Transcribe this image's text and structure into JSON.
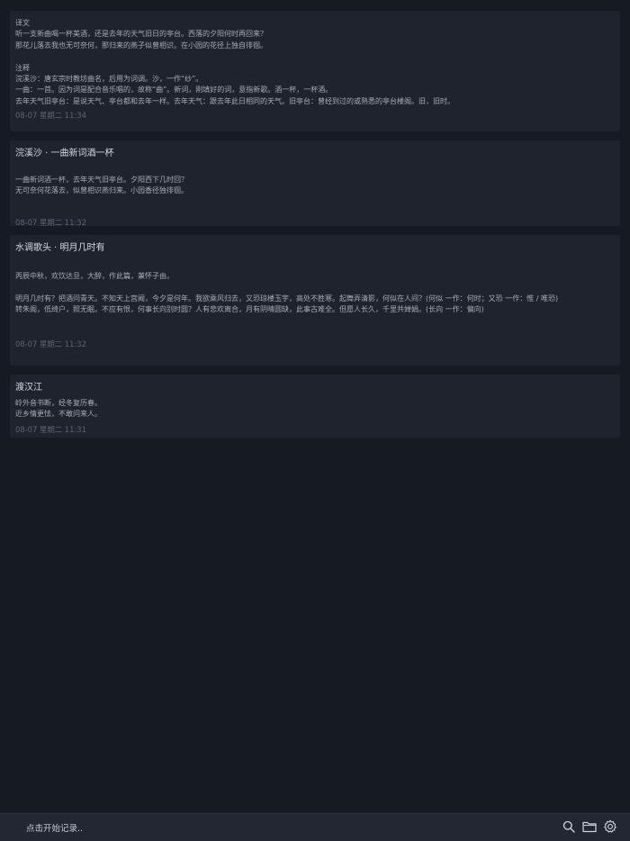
{
  "entries": [
    {
      "title": "",
      "body": "译文\n听一支新曲喝一杯美酒，还是去年的天气旧日的亭台。西落的夕阳何时再回来？\n那花儿落去我也无可奈何，那归来的燕子似曾相识。在小园的花径上独自徘徊。\n\n注释\n浣溪沙：唐玄宗时教坊曲名，后用为词调。沙，一作“纱”。\n一曲：一首。因为词是配合音乐唱的，故称“曲”。新词，刚填好的词，意指新歌。酒一杯，一杯酒。\n去年天气旧亭台：是说天气、亭台都和去年一样。去年天气：跟去年此日相同的天气。旧亭台：曾经到过的或熟悉的亭台楼阁。旧，旧时。",
      "time": "08-07 星期二 11:34"
    },
    {
      "title": "浣溪沙 · 一曲新词酒一杯",
      "body": "一曲新词酒一杯，去年天气旧亭台。夕阳西下几时回？\n无可奈何花落去，似曾相识燕归来。小园香径独徘徊。",
      "time": "08-07 星期二 11:32"
    },
    {
      "title": "水调歌头 · 明月几时有",
      "body": "丙辰中秋，欢饮达旦，大醉，作此篇，兼怀子由。\n\n明月几时有？把酒问青天。不知天上宫阙，今夕是何年。我欲乘风归去，又恐琼楼玉宇，高处不胜寒。起舞弄清影，何似在人间？(何似 一作：何时；又恐 一作：惟 / 唯恐)\n转朱阁，低绮户，照无眠。不应有恨，何事长向别时圆？人有悲欢离合，月有阴晴圆缺，此事古难全。但愿人长久，千里共婵娟。(长向 一作：偏向)",
      "time": "08-07 星期二 11:32"
    },
    {
      "title": "渡汉江",
      "body": "岭外音书断，经冬复历春。\n近乡情更怯，不敢问来人。",
      "time": "08-07 星期二 11:31"
    }
  ],
  "bottom_bar": {
    "prompt": "点击开始记录..",
    "icons": [
      "search-icon",
      "folder-icon",
      "settings-icon"
    ]
  }
}
